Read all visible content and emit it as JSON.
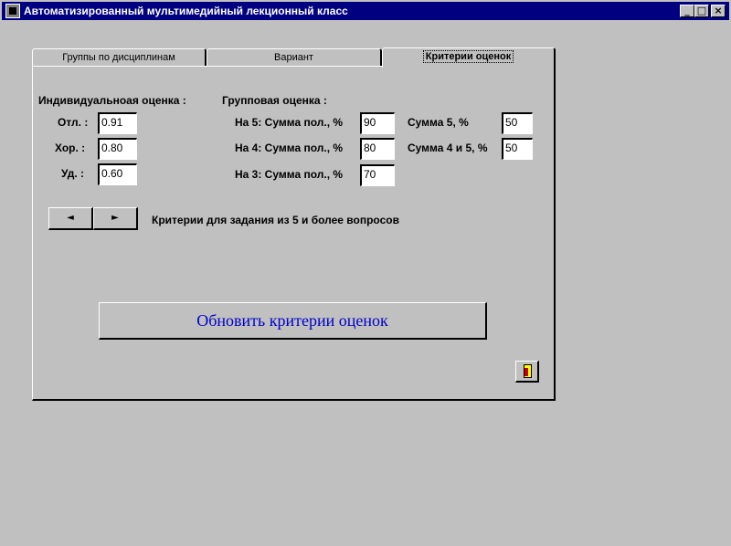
{
  "window": {
    "title": "Автоматизированный мультимедийный лекционный класс",
    "minimize_glyph": "_",
    "maximize_glyph": "□",
    "close_glyph": "×"
  },
  "tabs": [
    {
      "label": "Группы по дисциплинам",
      "active": false
    },
    {
      "label": "Вариант",
      "active": false
    },
    {
      "label": "Критерии оценок",
      "active": true
    }
  ],
  "individual": {
    "heading": "Индивидуальноая оценка :",
    "rows": [
      {
        "label": "Отл. :",
        "value": "0.91"
      },
      {
        "label": "Хор. :",
        "value": "0.80"
      },
      {
        "label": "Уд. :",
        "value": "0.60"
      }
    ]
  },
  "group": {
    "heading": "Групповая оценка :",
    "rows": [
      {
        "label": "На 5: Сумма пол., %",
        "value": "90"
      },
      {
        "label": "На 4: Сумма пол., %",
        "value": "80"
      },
      {
        "label": "На 3: Сумма пол., %",
        "value": "70"
      }
    ],
    "extra": [
      {
        "label": "Сумма 5, %",
        "value": "50"
      },
      {
        "label": "Сумма 4 и 5, %",
        "value": "50"
      }
    ]
  },
  "spinner": {
    "prev_glyph": "◄",
    "next_glyph": "►",
    "criteria_text": "Критерии для задания из 5 и более вопросов"
  },
  "update_button": {
    "label": "Обновить критерии оценок",
    "color": "#0000c8"
  },
  "exit_button": {
    "icon": "exit-door-icon"
  }
}
